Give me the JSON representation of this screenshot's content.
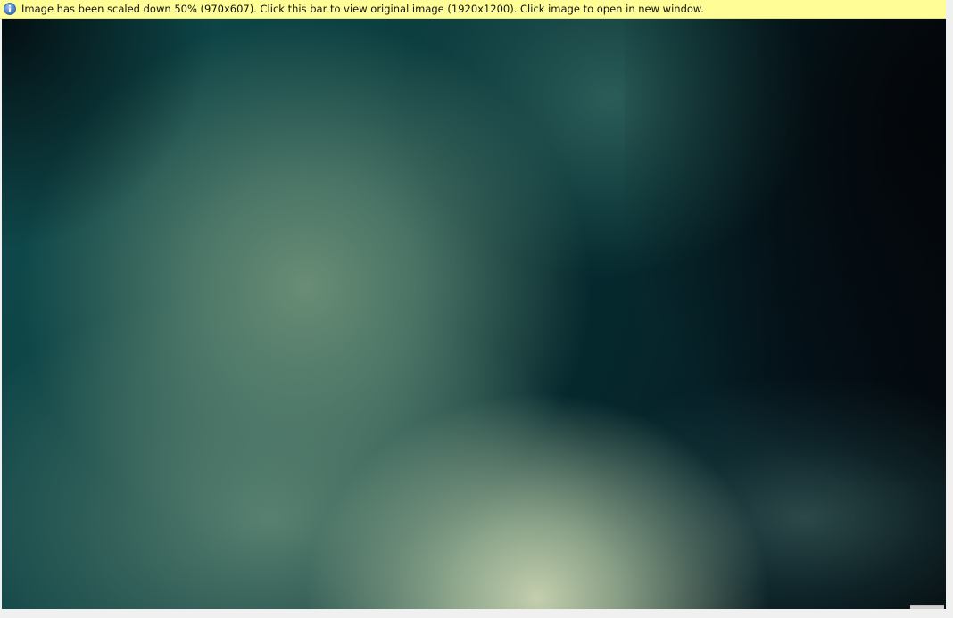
{
  "notice_bar": {
    "icon": "info-icon",
    "text": "Image has been scaled down 50% (970x607). Click this bar to view original image (1920x1200). Click image to open in new window.",
    "background_color": "#fffd96"
  },
  "image": {
    "description_colors": {
      "dark": "#04070b",
      "teal": "#0c3e40",
      "light": "#c8d3b2"
    }
  }
}
